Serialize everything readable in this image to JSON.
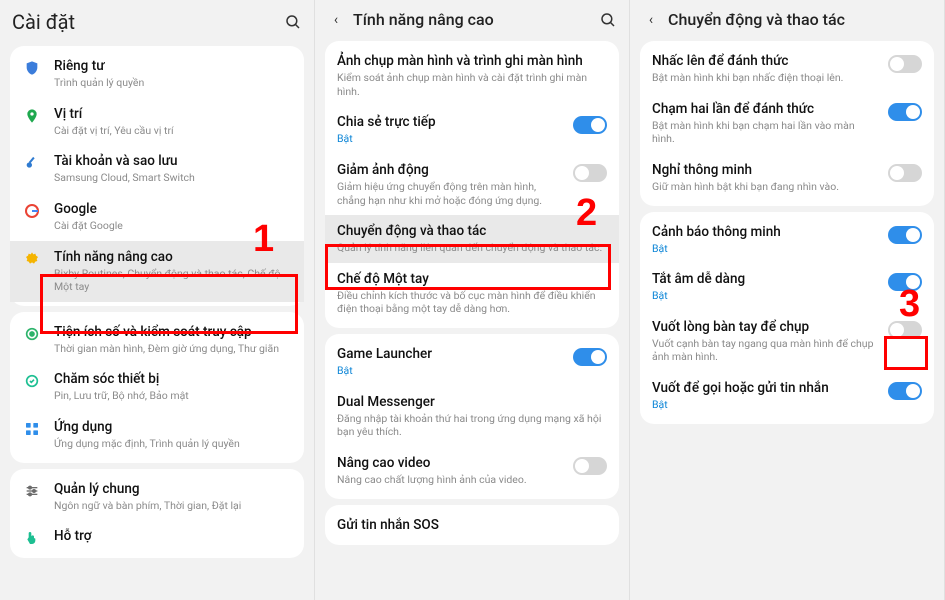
{
  "panel1": {
    "title": "Cài đặt",
    "items": [
      {
        "icon": "shield",
        "color": "#3b7ddb",
        "label": "Riêng tư",
        "sub": "Trình quản lý quyền"
      },
      {
        "icon": "pin",
        "color": "#1ea84e",
        "label": "Vị trí",
        "sub": "Cài đặt vị trí, Yêu cầu vị trí"
      },
      {
        "icon": "key",
        "color": "#2f7bd1",
        "label": "Tài khoản và sao lưu",
        "sub": "Samsung Cloud, Smart Switch"
      },
      {
        "icon": "google",
        "color": "#ea4335",
        "label": "Google",
        "sub": "Cài đặt Google"
      },
      {
        "icon": "gear",
        "color": "#f5b400",
        "label": "Tính năng nâng cao",
        "sub": "Bixby Routines, Chuyển động và thao tác, Chế độ Một tay"
      },
      {
        "icon": "access",
        "color": "#2db36b",
        "label": "Tiện ích số và kiểm soát truy cập",
        "sub": "Thời gian màn hình, Đèm giờ ứng dụng, Thư giãn"
      },
      {
        "icon": "care",
        "color": "#1dbf92",
        "label": "Chăm sóc thiết bị",
        "sub": "Pin, Lưu trữ, Bộ nhớ, Bảo mật"
      },
      {
        "icon": "apps",
        "color": "#2f8eea",
        "label": "Ứng dụng",
        "sub": "Ứng dụng mặc định, Trình quản lý quyền"
      },
      {
        "icon": "sliders",
        "color": "#6b6b6b",
        "label": "Quản lý chung",
        "sub": "Ngôn ngữ và bàn phím, Thời gian, Đặt lại"
      },
      {
        "icon": "hand",
        "color": "#1dbf92",
        "label": "Hỗ trợ",
        "sub": ""
      }
    ]
  },
  "panel2": {
    "title": "Tính năng nâng cao",
    "groups": [
      [
        {
          "label": "Ảnh chụp màn hình và trình ghi màn hình",
          "sub": "Kiểm soát ảnh chụp màn hình và cài đặt trình ghi màn hình."
        },
        {
          "label": "Chia sẻ trực tiếp",
          "sub": "Bật",
          "subAccent": true,
          "toggle": true,
          "on": true
        },
        {
          "label": "Giảm ảnh động",
          "sub": "Giảm hiệu ứng chuyển động trên màn hình, chẳng hạn như khi mở hoặc đóng ứng dụng.",
          "toggle": true,
          "on": false
        },
        {
          "label": "Chuyển động và thao tác",
          "sub": "Quản lý tính năng liên quan đến chuyển động và thao tác.",
          "sel": true
        },
        {
          "label": "Chế độ Một tay",
          "sub": "Điều chỉnh kích thước và bố cục màn hình để điều khiển điện thoại bằng một tay dễ dàng hơn."
        }
      ],
      [
        {
          "label": "Game Launcher",
          "sub": "Bật",
          "subAccent": true,
          "toggle": true,
          "on": true
        },
        {
          "label": "Dual Messenger",
          "sub": "Đăng nhập tài khoản thứ hai trong ứng dụng mạng xã hội bạn yêu thích."
        },
        {
          "label": "Nâng cao video",
          "sub": "Nâng cao chất lượng hình ảnh của video.",
          "toggle": true,
          "on": false
        }
      ],
      [
        {
          "label": "Gửi tin nhắn SOS",
          "sub": ""
        }
      ]
    ]
  },
  "panel3": {
    "title": "Chuyển động và thao tác",
    "groups": [
      [
        {
          "label": "Nhấc lên để đánh thức",
          "sub": "Bật màn hình khi bạn nhấc điện thoại lên.",
          "toggle": true,
          "on": false
        },
        {
          "label": "Chạm hai lần để đánh thức",
          "sub": "Bật màn hình khi bạn chạm hai lần vào màn hình.",
          "toggle": true,
          "on": true
        },
        {
          "label": "Nghỉ thông minh",
          "sub": "Giữ màn hình bật khi bạn đang nhìn vào.",
          "toggle": true,
          "on": false
        }
      ],
      [
        {
          "label": "Cảnh báo thông minh",
          "sub": "Bật",
          "subAccent": true,
          "toggle": true,
          "on": true
        },
        {
          "label": "Tắt âm dễ dàng",
          "sub": "Bật",
          "subAccent": true,
          "toggle": true,
          "on": true
        },
        {
          "label": "Vuốt lòng bàn tay để chụp",
          "sub": "Vuốt cạnh bàn tay ngang qua màn hình để chụp ảnh màn hình.",
          "toggle": true,
          "on": false
        },
        {
          "label": "Vuốt để gọi hoặc gửi tin nhắn",
          "sub": "Bật",
          "subAccent": true,
          "toggle": true,
          "on": true
        }
      ]
    ]
  },
  "annotations": {
    "n1": "1",
    "n2": "2",
    "n3": "3"
  }
}
